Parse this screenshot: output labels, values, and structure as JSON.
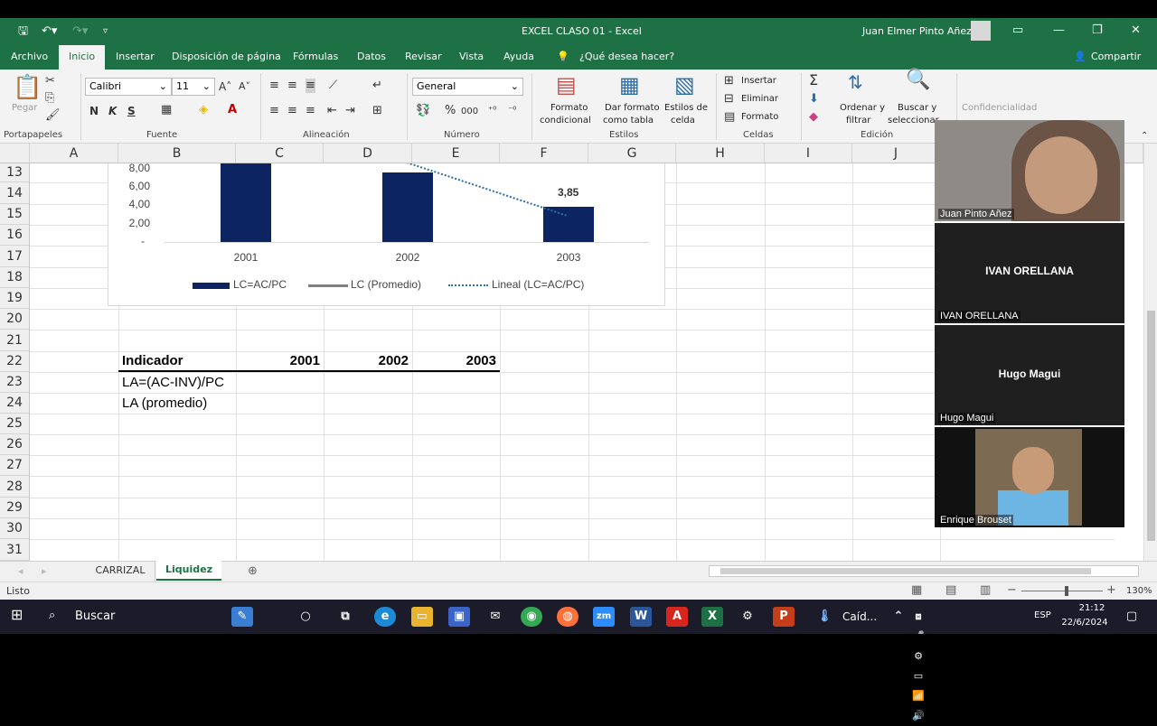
{
  "window": {
    "title": "EXCEL CLASO 01  -  Excel",
    "user": "Juan Elmer Pinto Añez"
  },
  "tabs": [
    "Archivo",
    "Inicio",
    "Insertar",
    "Disposición de página",
    "Fórmulas",
    "Datos",
    "Revisar",
    "Vista",
    "Ayuda",
    "¿Qué desea hacer?"
  ],
  "share": "Compartir",
  "ribbon": {
    "clipboard": {
      "paste": "Pegar",
      "group": "Portapapeles"
    },
    "font": {
      "name": "Calibri",
      "size": "11",
      "group": "Fuente",
      "bold": "N",
      "italic": "K",
      "underline": "S"
    },
    "alignment": {
      "group": "Alineación"
    },
    "number": {
      "format": "General",
      "group": "Número",
      "percent": "%",
      "thousands": "000"
    },
    "styles": {
      "conditional": "Formato",
      "conditional2": "condicional",
      "table": "Dar formato",
      "table2": "como tabla",
      "cell": "Estilos de",
      "cell2": "celda",
      "group": "Estilos"
    },
    "cells": {
      "insert": "Insertar",
      "delete": "Eliminar",
      "format": "Formato",
      "group": "Celdas"
    },
    "editing": {
      "sort": "Ordenar y",
      "sort2": "filtrar",
      "find": "Buscar y",
      "find2": "seleccionar",
      "group": "Edición"
    },
    "confidential": "Confidencialidad"
  },
  "columns": [
    "A",
    "B",
    "C",
    "D",
    "E",
    "F",
    "G",
    "H",
    "I",
    "J"
  ],
  "rows": [
    "13",
    "14",
    "15",
    "16",
    "17",
    "18",
    "19",
    "20",
    "21",
    "22",
    "23",
    "24",
    "25",
    "26",
    "27",
    "28",
    "29",
    "30",
    "31"
  ],
  "table": {
    "header": [
      "Indicador",
      "2001",
      "2002",
      "2003"
    ],
    "rows": [
      "LA=(AC-INV)/PC",
      "LA (promedio)"
    ]
  },
  "chart_data": {
    "type": "bar",
    "categories": [
      "2001",
      "2002",
      "2003"
    ],
    "series": [
      {
        "name": "LC=AC/PC",
        "values": [
          null,
          7.5,
          3.85
        ]
      },
      {
        "name": "LC (Promedio)",
        "values": []
      },
      {
        "name": "Lineal (LC=AC/PC)",
        "values": []
      }
    ],
    "ytick_labels": [
      "8,00",
      "6,00",
      "4,00",
      "2,00",
      "-"
    ],
    "data_labels": [
      "3,85"
    ],
    "ylim": [
      0,
      8
    ]
  },
  "sheet_tabs": [
    "CARRIZAL",
    "Liquidez"
  ],
  "status": {
    "text": "Listo",
    "zoom": "130%"
  },
  "taskbar": {
    "search": "Buscar",
    "weather": "Caíd...",
    "lang": "ESP",
    "time": "21:12",
    "date": "22/6/2024"
  },
  "participants": [
    "Juan Pinto Añez",
    "IVAN ORELLANA",
    "Hugo Magui",
    "Enrique Brouset"
  ],
  "colors": {
    "excel_green": "#1e7145",
    "bar": "#0d2463",
    "trend": "#2e6da4"
  }
}
